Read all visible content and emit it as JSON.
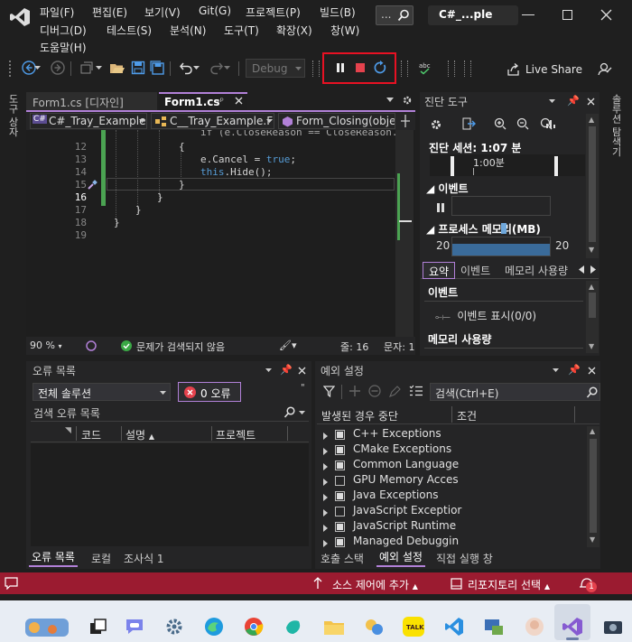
{
  "window": {
    "title": "C#_...ple"
  },
  "menu": {
    "row1": [
      "파일(F)",
      "편집(E)",
      "보기(V)",
      "Git(G)",
      "프로젝트(P)",
      "빌드(B)"
    ],
    "row2": [
      "디버그(D)",
      "테스트(S)",
      "분석(N)",
      "도구(T)",
      "확장(X)",
      "창(W)"
    ],
    "row3": [
      "도움말(H)"
    ],
    "ellipsis": "..."
  },
  "toolbar": {
    "config": "Debug",
    "live_share": "Live Share"
  },
  "side_left": "도구 상자",
  "side_right": "솔루션 탐색기",
  "editor": {
    "tabs": [
      "Form1.cs [디자인]",
      "Form1.cs"
    ],
    "nav": [
      "C#_Tray_Example",
      "C__Tray_Example.F",
      "Form_Closing(obje"
    ],
    "line_numbers": [
      "12",
      "13",
      "14",
      "15",
      "16",
      "17",
      "18",
      "19"
    ],
    "code_top": "if (e.CloseReason == CloseReason.UserClos",
    "code14a": "e.Cancel = ",
    "code14b": "true",
    "code14c": ";",
    "code15a": "this",
    "code15b": ".Hide();",
    "status": {
      "zoom": "90 %",
      "issues": "문제가 검색되지 않음",
      "line": "줄: 16",
      "col": "문자: 1"
    }
  },
  "diag": {
    "title": "진단 도구",
    "session": "진단 세션: 1:07 분",
    "time_label": "1:00분",
    "events": "이벤트",
    "process_mem": "프로세스 메모리(MB)",
    "mem_left": "20",
    "mem_right": "20",
    "tabs": [
      "요약",
      "이벤트",
      "메모리 사용량"
    ],
    "sec_events": "이벤트",
    "show_events": "이벤트 표시(0/0)",
    "sec_memory": "메모리 사용량"
  },
  "errors": {
    "title": "오류 목록",
    "scope": "전체 솔루션",
    "count": "0 오류",
    "search": "검색 오류 목록",
    "cols": [
      "코드",
      "설명",
      "프로젝트"
    ],
    "bottom_tabs": [
      "오류 목록",
      "로컬",
      "조사식 1"
    ]
  },
  "exceptions": {
    "title": "예외 설정",
    "search": "검색(Ctrl+E)",
    "col1": "발생된 경우 중단",
    "col2": "조건",
    "items": [
      {
        "label": "C++ Exceptions",
        "checked": true
      },
      {
        "label": "CMake Exceptions",
        "checked": true
      },
      {
        "label": "Common Language",
        "checked": true
      },
      {
        "label": "GPU Memory Acces",
        "checked": false
      },
      {
        "label": "Java Exceptions",
        "checked": true
      },
      {
        "label": "JavaScript Exceptior",
        "checked": false
      },
      {
        "label": "JavaScript Runtime",
        "checked": true
      },
      {
        "label": "Managed Debuggin",
        "checked": true
      }
    ],
    "bottom_tabs": [
      "호출 스택",
      "예외 설정",
      "직접 실행 창"
    ]
  },
  "statusbar": {
    "source_control": "소스 제어에 추가",
    "repo": "리포지토리 선택",
    "notif_count": "1"
  },
  "colors": {
    "statusbar": "#9b1b30",
    "accent": "#b180d7",
    "highlight_box": "#e81123"
  }
}
